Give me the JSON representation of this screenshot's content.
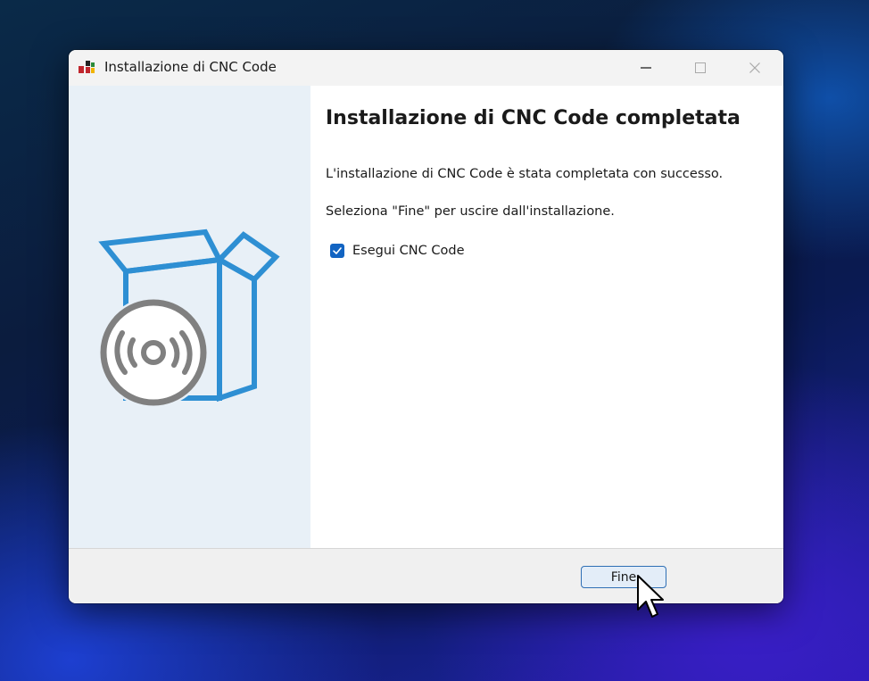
{
  "window": {
    "title": "Installazione di CNC Code",
    "controls": [
      "minimize-icon",
      "maximize-icon",
      "close-icon"
    ]
  },
  "main": {
    "heading": "Installazione di CNC Code completata",
    "line1": "L'installazione di CNC Code è stata completata con successo.",
    "line2": "Seleziona \"Fine\" per uscire dall'installazione.",
    "checkbox": {
      "label": "Esegui CNC Code",
      "checked": true
    }
  },
  "footer": {
    "finish_label": "Fine"
  },
  "colors": {
    "accent": "#1264c2",
    "illustration_blue": "#2e8fd3",
    "disc_gray": "#808080",
    "left_panel": "#e8f0f7"
  }
}
